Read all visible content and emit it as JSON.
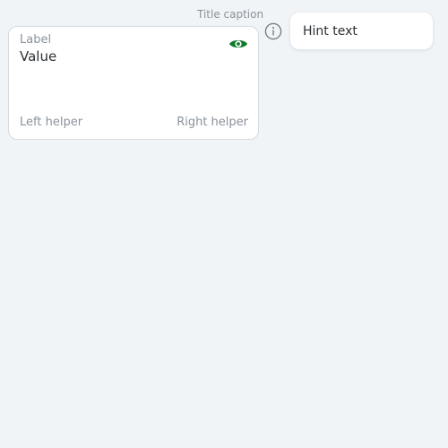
{
  "caption": "Title caption",
  "field": {
    "label": "Label",
    "value": "Value",
    "helper_left": "Left helper",
    "helper_right": "Right helper",
    "toggle_icon": "eye-icon",
    "accent_color": "#0f7a2a"
  },
  "info": {
    "icon": "info-icon"
  },
  "hint": {
    "text": "Hint text"
  }
}
